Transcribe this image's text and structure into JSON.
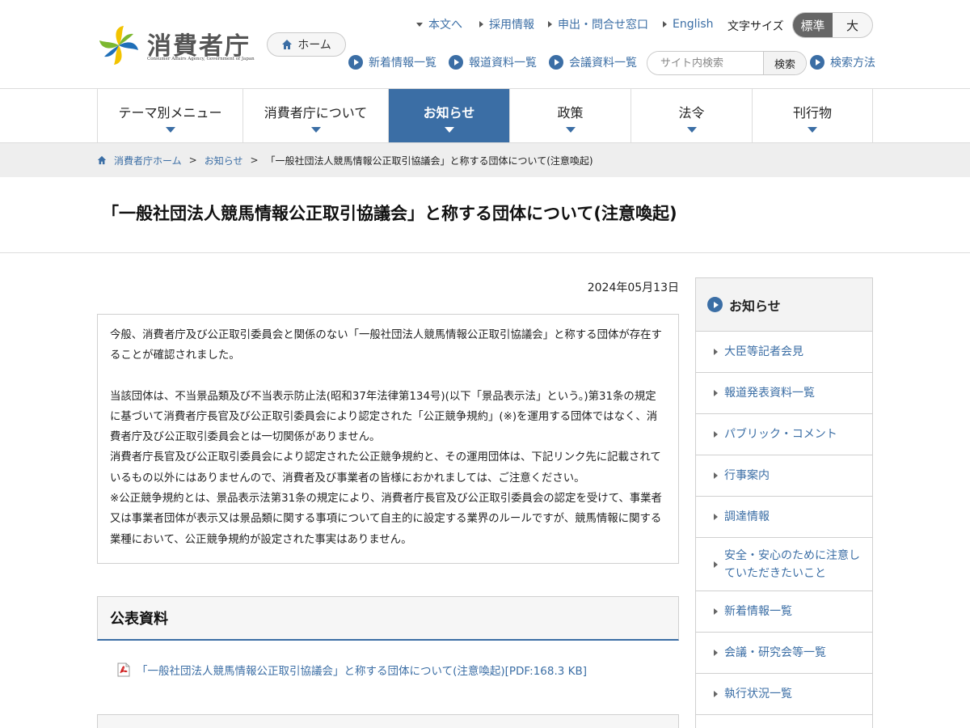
{
  "header": {
    "logo_text": "消費者庁",
    "logo_sub": "Consumer Affairs Agency, Government of Japan",
    "home_label": "ホーム",
    "util_links": [
      {
        "label": "本文へ"
      },
      {
        "label": "採用情報"
      },
      {
        "label": "申出・問合せ窓口"
      },
      {
        "label": "English"
      }
    ],
    "fontsize_label": "文字サイズ",
    "fontsize_options": [
      "標準",
      "大"
    ],
    "sub_links": [
      {
        "label": "新着情報一覧"
      },
      {
        "label": "報道資料一覧"
      },
      {
        "label": "会議資料一覧"
      }
    ],
    "search_placeholder": "サイト内検索",
    "search_button": "検索",
    "search_help": "検索方法"
  },
  "gnav": [
    {
      "label": "テーマ別メニュー",
      "active": false
    },
    {
      "label": "消費者庁について",
      "active": false
    },
    {
      "label": "お知らせ",
      "active": true
    },
    {
      "label": "政策",
      "active": false
    },
    {
      "label": "法令",
      "active": false
    },
    {
      "label": "刊行物",
      "active": false
    }
  ],
  "breadcrumb": {
    "home": "消費者庁ホーム",
    "section": "お知らせ",
    "separator": ">",
    "current": "「一般社団法人競馬情報公正取引協議会」と称する団体について(注意喚起)"
  },
  "page_title": "「一般社団法人競馬情報公正取引協議会」と称する団体について(注意喚起)",
  "date": "2024年05月13日",
  "notice": {
    "p1": "今般、消費者庁及び公正取引委員会と関係のない「一般社団法人競馬情報公正取引協議会」と称する団体が存在することが確認されました。",
    "p2": "当該団体は、不当景品類及び不当表示防止法(昭和37年法律第134号)(以下「景品表示法」という。)第31条の規定に基づいて消費者庁長官及び公正取引委員会により認定された「公正競争規約」(※)を運用する団体ではなく、消費者庁及び公正取引委員会とは一切関係がありません。",
    "p3": "消費者庁長官及び公正取引委員会により認定された公正競争規約と、その運用団体は、下記リンク先に記載されているもの以外にはありませんので、消費者及び事業者の皆様におかれましては、ご注意ください。",
    "p4": "※公正競争規約とは、景品表示法第31条の規定により、消費者庁長官及び公正取引委員会の認定を受けて、事業者又は事業者団体が表示又は景品類に関する事項について自主的に設定する業界のルールですが、競馬情報に関する業種において、公正競争規約が設定された事実はありません。"
  },
  "public_materials": {
    "heading": "公表資料",
    "link": "「一般社団法人競馬情報公正取引協議会」と称する団体について(注意喚起)[PDF:168.3 KB]"
  },
  "side_nav": {
    "heading": "お知らせ",
    "items": [
      "大臣等記者会見",
      "報道発表資料一覧",
      "パブリック・コメント",
      "行事案内",
      "調達情報",
      "安全・安心のために注意していただきたいこと",
      "新着情報一覧",
      "会議・研究会等一覧",
      "執行状況一覧"
    ]
  },
  "colors": {
    "accent": "#3b6ea5",
    "logo_yellow": "#f2c300",
    "logo_blue": "#1f6fb8",
    "logo_green": "#7cb82f"
  }
}
